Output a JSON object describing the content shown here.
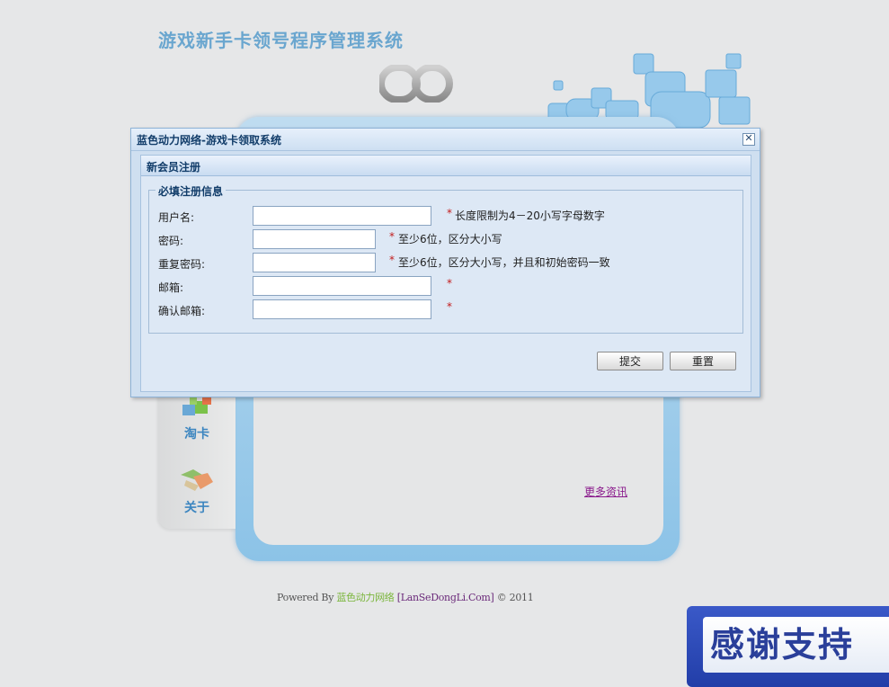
{
  "site": {
    "title": "游戏新手卡领号程序管理系统"
  },
  "sidebar": {
    "items": [
      {
        "label": "淘卡",
        "icon": "cube-blocks-icon"
      },
      {
        "label": "关于",
        "icon": "handshake-icon"
      }
    ]
  },
  "main": {
    "more_news": "更多资讯"
  },
  "footer": {
    "powered_by": "Powered By",
    "company": "蓝色动力网络",
    "site": "[LanSeDongLi.Com]",
    "copyright": "© 2011"
  },
  "banner": {
    "text": "感谢支持"
  },
  "dialog": {
    "title": "蓝色动力网络-游戏卡领取系统",
    "close_symbol": "✕",
    "section_title": "新会员注册",
    "fieldset_legend": "必填注册信息",
    "fields": [
      {
        "label": "用户名:",
        "value": "",
        "required_mark": "*",
        "hint": "长度限制为4－20小写字母数字"
      },
      {
        "label": "密码:",
        "value": "",
        "required_mark": "*",
        "hint": "至少6位，区分大小写"
      },
      {
        "label": "重复密码:",
        "value": "",
        "required_mark": "*",
        "hint": "至少6位，区分大小写，并且和初始密码一致"
      },
      {
        "label": "邮箱:",
        "value": "",
        "required_mark": "*",
        "hint": ""
      },
      {
        "label": "确认邮箱:",
        "value": "",
        "required_mark": "*",
        "hint": ""
      }
    ],
    "submit_label": "提交",
    "reset_label": "重置"
  },
  "colors": {
    "accent": "#6aa6cf",
    "dialog_title": "#123d6a",
    "required": "#c21b1b",
    "link_visited": "#8a1a8c"
  }
}
